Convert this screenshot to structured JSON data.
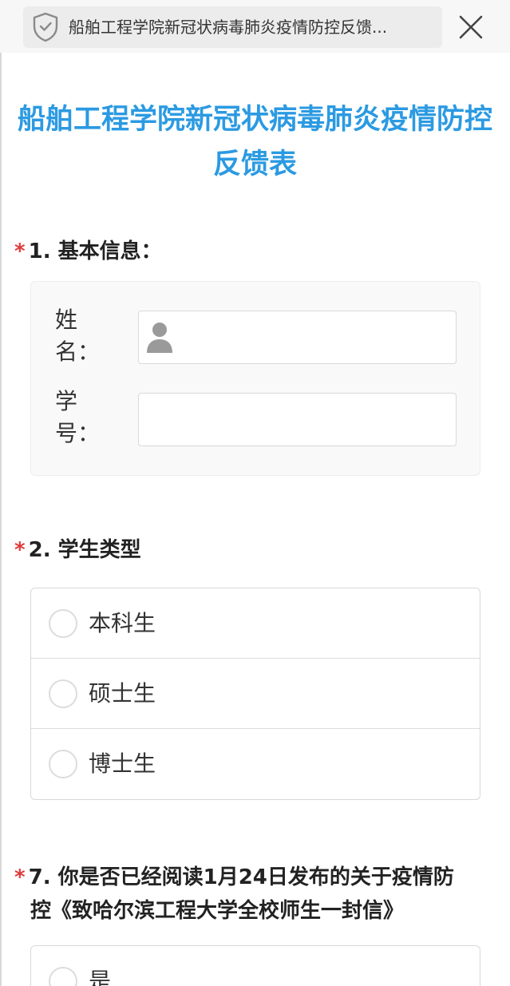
{
  "browser": {
    "url_title": "船舶工程学院新冠状病毒肺炎疫情防控反馈...",
    "security_icon": "shield-icon",
    "close_icon": "close-icon"
  },
  "form": {
    "title_line1": "船舶工程学院新冠状病毒肺炎疫情防控",
    "title_line2": "反馈表",
    "accent_color": "#2b9ae2",
    "required_color": "#e03b3b"
  },
  "questions": [
    {
      "required_mark": "*",
      "title": "1. 基本信息：",
      "fields": [
        {
          "label_line1": "姓",
          "label_line2": "名：",
          "value": "",
          "icon": "person-icon"
        },
        {
          "label_line1": "学",
          "label_line2": "号：",
          "value": ""
        }
      ]
    },
    {
      "required_mark": "*",
      "title": "2. 学生类型",
      "options": [
        "本科生",
        "硕士生",
        "博士生"
      ]
    },
    {
      "required_mark": "*",
      "title_line1": "7. 你是否已经阅读1月24日发布的关于疫情防",
      "title_line2": "控《致哈尔滨工程大学全校师生一封信》",
      "options": [
        "是"
      ]
    }
  ]
}
